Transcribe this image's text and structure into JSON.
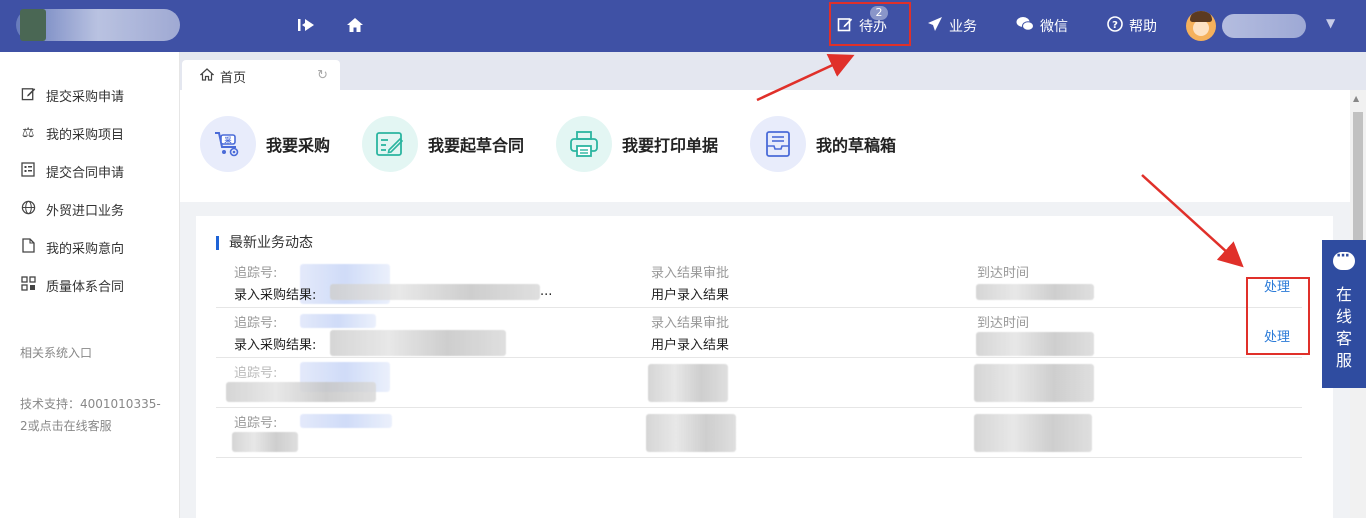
{
  "header": {
    "pending_label": "待办",
    "pending_count": "2",
    "business_label": "业务",
    "wechat_label": "微信",
    "help_label": "帮助"
  },
  "sidebar": {
    "items": [
      {
        "label": "提交采购申请",
        "icon": "edit-icon"
      },
      {
        "label": "我的采购项目",
        "icon": "scale-icon"
      },
      {
        "label": "提交合同申请",
        "icon": "document-list-icon"
      },
      {
        "label": "外贸进口业务",
        "icon": "globe-icon"
      },
      {
        "label": "我的采购意向",
        "icon": "file-icon"
      },
      {
        "label": "质量体系合同",
        "icon": "grid-icon"
      }
    ],
    "related_title": "相关系统入口",
    "support_line1": "技术支持：4001010335-",
    "support_line2": "2或点击在线客服"
  },
  "tabs": {
    "home_label": "首页"
  },
  "shortcuts": [
    {
      "label": "我要采购",
      "icon": "purchase-cart-icon",
      "color": "#e8ecfb"
    },
    {
      "label": "我要起草合同",
      "icon": "draft-contract-icon",
      "color": "#e3f6f3"
    },
    {
      "label": "我要打印单据",
      "icon": "printer-icon",
      "color": "#e3f6f3"
    },
    {
      "label": "我的草稿箱",
      "icon": "drafts-box-icon",
      "color": "#e8ecfb"
    }
  ],
  "feed": {
    "title": "最新业务动态",
    "rows": [
      {
        "tracking_label": "追踪号:",
        "result_label": "录入采购结果:",
        "result_suffix": "...",
        "stage_label": "录入结果审批",
        "stage_value": "用户录入结果",
        "time_label": "到达时间",
        "action": "处理"
      },
      {
        "tracking_label": "追踪号:",
        "result_label": "录入采购结果:",
        "result_suffix": "",
        "stage_label": "录入结果审批",
        "stage_value": "用户录入结果",
        "time_label": "到达时间",
        "action": "处理"
      },
      {
        "tracking_label": "追踪号:"
      },
      {
        "tracking_label": "追踪号:"
      }
    ]
  },
  "customer_service": {
    "label": "在线客服"
  },
  "colors": {
    "header_bg": "#3f51a5",
    "highlight": "#e0302a",
    "link": "#2b7bd8",
    "accent": "#1e63d6"
  }
}
